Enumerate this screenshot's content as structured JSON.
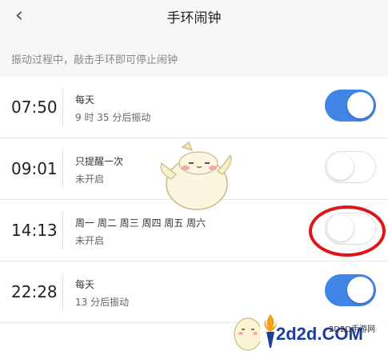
{
  "header": {
    "title": "手环闹钟",
    "back_icon": "chevron-left-icon"
  },
  "hint": "振动过程中，敲击手环即可停止闹钟",
  "alarms": [
    {
      "time": "07:50",
      "repeat": "每天",
      "status": "9 时 35 分后振动",
      "enabled": true
    },
    {
      "time": "09:01",
      "repeat": "只提醒一次",
      "status": "未开启",
      "enabled": false
    },
    {
      "time": "14:13",
      "repeat": "周一 周二 周三 周四 周五 周六",
      "status": "未开启",
      "enabled": false
    },
    {
      "time": "22:28",
      "repeat": "每天",
      "status": "13 分后振动",
      "enabled": true
    }
  ],
  "watermark": {
    "site": "2d2d.COM",
    "name": "2D2D手游网"
  },
  "colors": {
    "toggle_on": "#3f86e6",
    "highlight_circle": "#e1141a",
    "background": "#f7f7f7"
  }
}
